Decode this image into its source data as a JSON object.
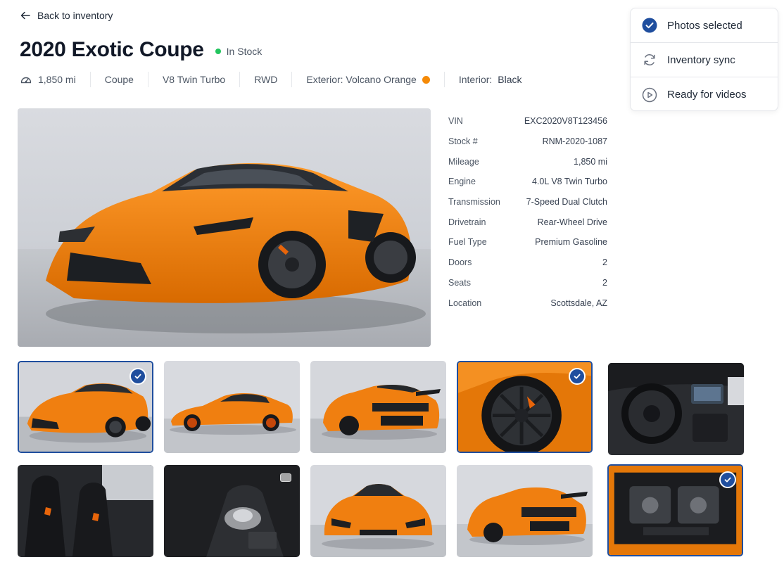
{
  "nav": {
    "back_label": "Back to inventory"
  },
  "vehicle": {
    "title": "2020 Exotic Coupe",
    "stock_status": "In Stock",
    "stock_status_color": "#22c55e"
  },
  "specs": {
    "mileage": "1,850 mi",
    "body": "Coupe",
    "engine": "V8 Twin Turbo",
    "drive": "RWD",
    "exterior": "Exterior: Volcano Orange",
    "exterior_swatch": "#f58a07",
    "interior_label": "Interior:",
    "interior_value": "Black"
  },
  "status_panel": {
    "items": [
      {
        "label": "Photos selected",
        "icon": "check-circle-icon"
      },
      {
        "label": "Inventory sync",
        "icon": "sync-icon"
      },
      {
        "label": "Ready for videos",
        "icon": "play-circle-icon"
      }
    ]
  },
  "details": [
    {
      "label": "VIN",
      "value": "EXC2020V8T123456"
    },
    {
      "label": "Stock #",
      "value": "RNM-2020-1087"
    },
    {
      "label": "Mileage",
      "value": "1,850 mi"
    },
    {
      "label": "Engine",
      "value": "4.0L V8 Twin Turbo"
    },
    {
      "label": "Transmission",
      "value": "7-Speed Dual Clutch"
    },
    {
      "label": "Drivetrain",
      "value": "Rear-Wheel Drive"
    },
    {
      "label": "Fuel Type",
      "value": "Premium Gasoline"
    },
    {
      "label": "Doors",
      "value": "2"
    },
    {
      "label": "Seats",
      "value": "2"
    },
    {
      "label": "Location",
      "value": "Scottsdale, AZ"
    }
  ],
  "gallery": [
    {
      "view": "front three-quarter",
      "selected": true
    },
    {
      "view": "side profile",
      "selected": false
    },
    {
      "view": "rear three-quarter",
      "selected": false
    },
    {
      "view": "wheel close-up",
      "selected": true
    },
    {
      "view": "dashboard",
      "selected": false
    },
    {
      "view": "seats",
      "selected": false
    },
    {
      "view": "center console",
      "selected": false
    },
    {
      "view": "front",
      "selected": false
    },
    {
      "view": "rear three-quarter",
      "selected": false
    },
    {
      "view": "engine bay",
      "selected": true
    }
  ],
  "colors": {
    "accent": "#1f4e9e",
    "car_orange": "#f58a07"
  }
}
